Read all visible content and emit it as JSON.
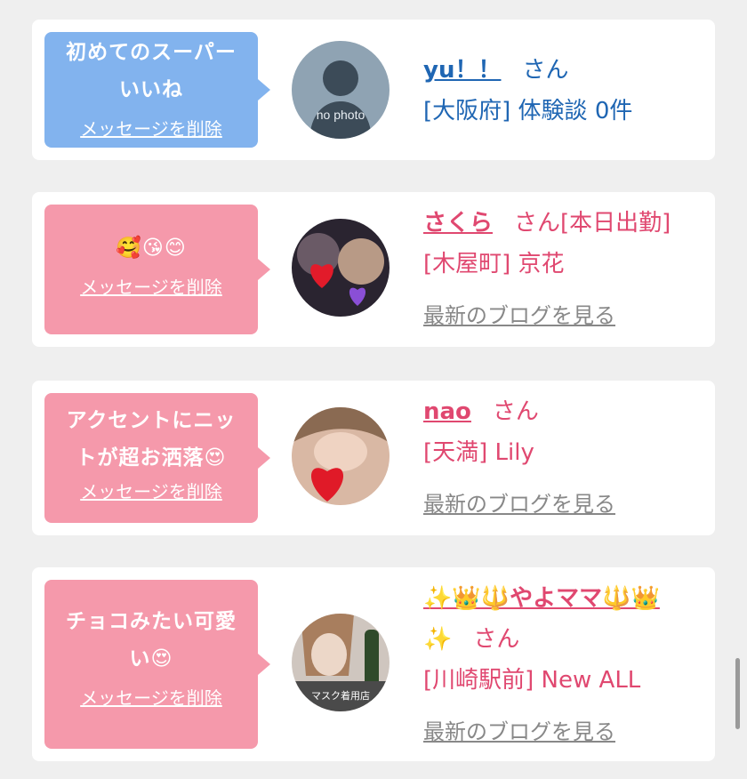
{
  "colors": {
    "blue_bubble": "#82b3ee",
    "pink_bubble": "#f599ab",
    "blue_text": "#1f66b3",
    "pink_text": "#e04870"
  },
  "delete_label": "メッセージを削除",
  "blog_label": "最新のブログを見る",
  "items": [
    {
      "message_line1": "初めてのスーパー",
      "message_line2": "いいね",
      "avatar_text": "no photo",
      "name": "yu！！",
      "suffix": "さん",
      "location": "[大阪府] 体験談 0件"
    },
    {
      "message_line1": "🥰😘😊",
      "name": "さくら",
      "suffix": "さん[本日出勤]",
      "location": "[木屋町] 京花"
    },
    {
      "message_line1": "アクセントにニッ",
      "message_line2": "トが超お洒落😍",
      "name": "nao",
      "suffix": "さん",
      "location": "[天満] Lily"
    },
    {
      "message_line1": "チョコみたい可愛",
      "message_line2": "い😍",
      "avatar_text": "マスク着用店",
      "name": "✨👑🔱やよママ🔱👑",
      "name_line2": "✨",
      "suffix": "さん",
      "location": "[川崎駅前] New ALL"
    }
  ]
}
